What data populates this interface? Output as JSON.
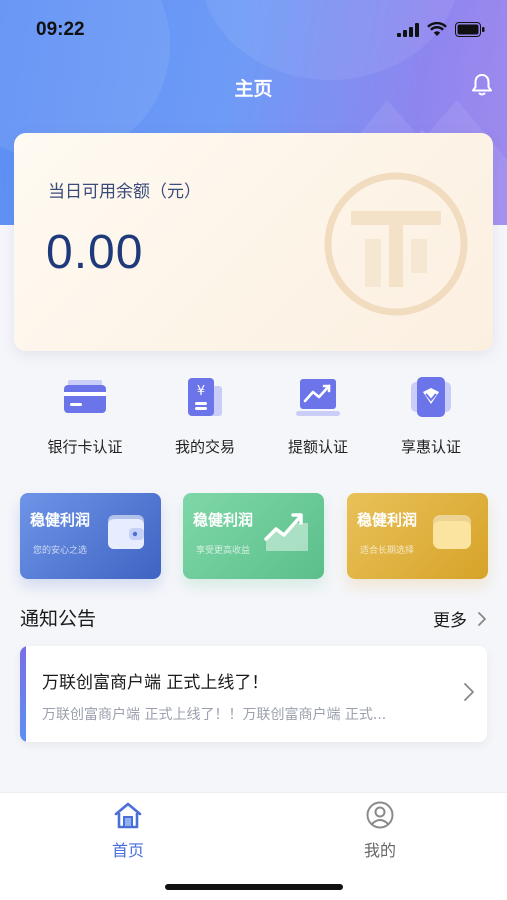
{
  "status_bar": {
    "time": "09:22"
  },
  "header": {
    "title": "主页"
  },
  "balance": {
    "label": "当日可用余额（元）",
    "value": "0.00"
  },
  "quick_actions": [
    {
      "label": "银行卡认证",
      "icon": "bank-card-icon"
    },
    {
      "label": "我的交易",
      "icon": "transaction-icon"
    },
    {
      "label": "提额认证",
      "icon": "chart-up-icon"
    },
    {
      "label": "享惠认证",
      "icon": "discount-badge-icon"
    }
  ],
  "promos": [
    {
      "title": "稳健利润",
      "subtitle": "您的安心之选",
      "icon": "wallet-icon",
      "color": "#3f63c2"
    },
    {
      "title": "稳健利润",
      "subtitle": "享受更高收益",
      "icon": "growth-chart-icon",
      "color": "#5bbf8b"
    },
    {
      "title": "稳健利润",
      "subtitle": "适合长期选择",
      "icon": "gold-card-icon",
      "color": "#d6a328"
    }
  ],
  "notice": {
    "section_title": "通知公告",
    "more_label": "更多",
    "headline": "万联创富商户端 正式上线了！",
    "summary": "万联创富商户端 正式上线了！！万联创富商户端 正式..."
  },
  "tabbar": {
    "tabs": [
      {
        "label": "首页",
        "icon": "home-icon",
        "active": true
      },
      {
        "label": "我的",
        "icon": "profile-icon",
        "active": false
      }
    ]
  },
  "colors": {
    "accent": "#4a6fd8",
    "header_gradient_start": "#5d8ff5",
    "header_gradient_end": "#a08aee"
  }
}
